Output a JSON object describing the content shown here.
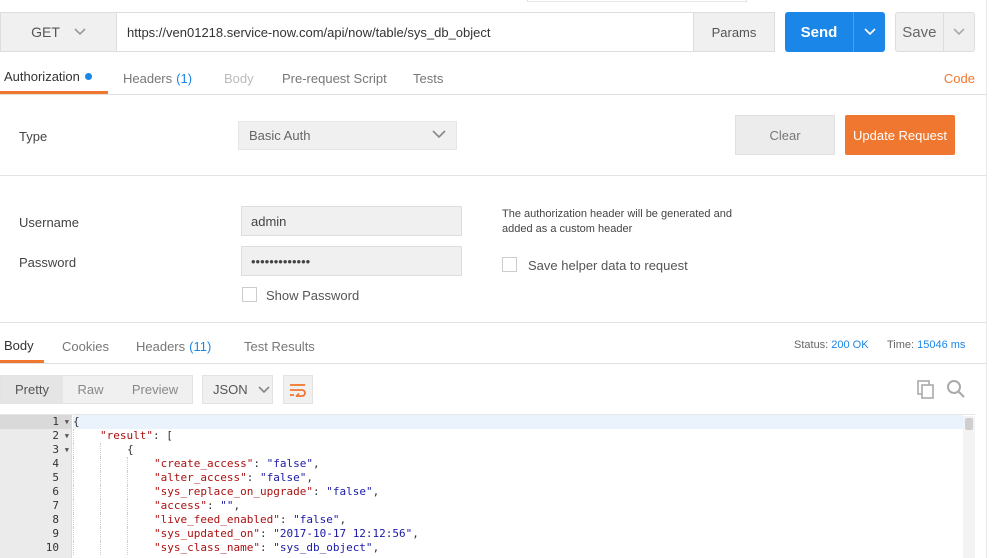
{
  "request": {
    "method": "GET",
    "url": "https://ven01218.service-now.com/api/now/table/sys_db_object",
    "params_label": "Params",
    "send_label": "Send",
    "save_label": "Save"
  },
  "request_tabs": {
    "authorization": "Authorization",
    "headers": "Headers",
    "headers_count": "(1)",
    "body": "Body",
    "prerequest": "Pre-request Script",
    "tests": "Tests",
    "code": "Code"
  },
  "auth": {
    "type_label": "Type",
    "type_value": "Basic Auth",
    "clear_label": "Clear",
    "update_label": "Update Request",
    "username_label": "Username",
    "username_value": "admin",
    "password_label": "Password",
    "password_value": "•••••••••••••",
    "show_password_label": "Show Password",
    "help_text": "The authorization header will be generated and added as a custom header",
    "save_helper_label": "Save helper data to request"
  },
  "response_tabs": {
    "body": "Body",
    "cookies": "Cookies",
    "headers": "Headers",
    "headers_count": "(11)",
    "test_results": "Test Results",
    "status_label": "Status:",
    "status_value": "200 OK",
    "time_label": "Time:",
    "time_value": "15046 ms"
  },
  "body_toolbar": {
    "pretty": "Pretty",
    "raw": "Raw",
    "preview": "Preview",
    "format": "JSON"
  },
  "code_lines": [
    {
      "n": "1",
      "fold": true,
      "indent": 0,
      "key": "",
      "text": "{"
    },
    {
      "n": "2",
      "fold": true,
      "indent": 1,
      "key": "\"result\"",
      "text": ": ["
    },
    {
      "n": "3",
      "fold": true,
      "indent": 2,
      "key": "",
      "text": "{"
    },
    {
      "n": "4",
      "fold": false,
      "indent": 3,
      "key": "\"create_access\"",
      "val": "\"false\"",
      "tail": ","
    },
    {
      "n": "5",
      "fold": false,
      "indent": 3,
      "key": "\"alter_access\"",
      "val": "\"false\"",
      "tail": ","
    },
    {
      "n": "6",
      "fold": false,
      "indent": 3,
      "key": "\"sys_replace_on_upgrade\"",
      "val": "\"false\"",
      "tail": ","
    },
    {
      "n": "7",
      "fold": false,
      "indent": 3,
      "key": "\"access\"",
      "val": "\"\"",
      "tail": ","
    },
    {
      "n": "8",
      "fold": false,
      "indent": 3,
      "key": "\"live_feed_enabled\"",
      "val": "\"false\"",
      "tail": ","
    },
    {
      "n": "9",
      "fold": false,
      "indent": 3,
      "key": "\"sys_updated_on\"",
      "val": "\"2017-10-17 12:12:56\"",
      "tail": ","
    },
    {
      "n": "10",
      "fold": false,
      "indent": 3,
      "key": "\"sys_class_name\"",
      "val": "\"sys_db_object\"",
      "tail": ","
    }
  ],
  "colors": {
    "send": "#1a86e8",
    "accent_orange": "#f0772f",
    "json_key": "#a11",
    "json_string": "#1a1aa6"
  },
  "icons": {
    "method_dropdown": "chevron-down-icon",
    "send_dropdown": "chevron-down-icon",
    "save_dropdown": "chevron-down-icon",
    "type_dropdown": "chevron-down-icon",
    "format_dropdown": "chevron-down-icon",
    "wrap": "wrap-lines-icon",
    "copy": "copy-icon",
    "search": "search-icon"
  }
}
